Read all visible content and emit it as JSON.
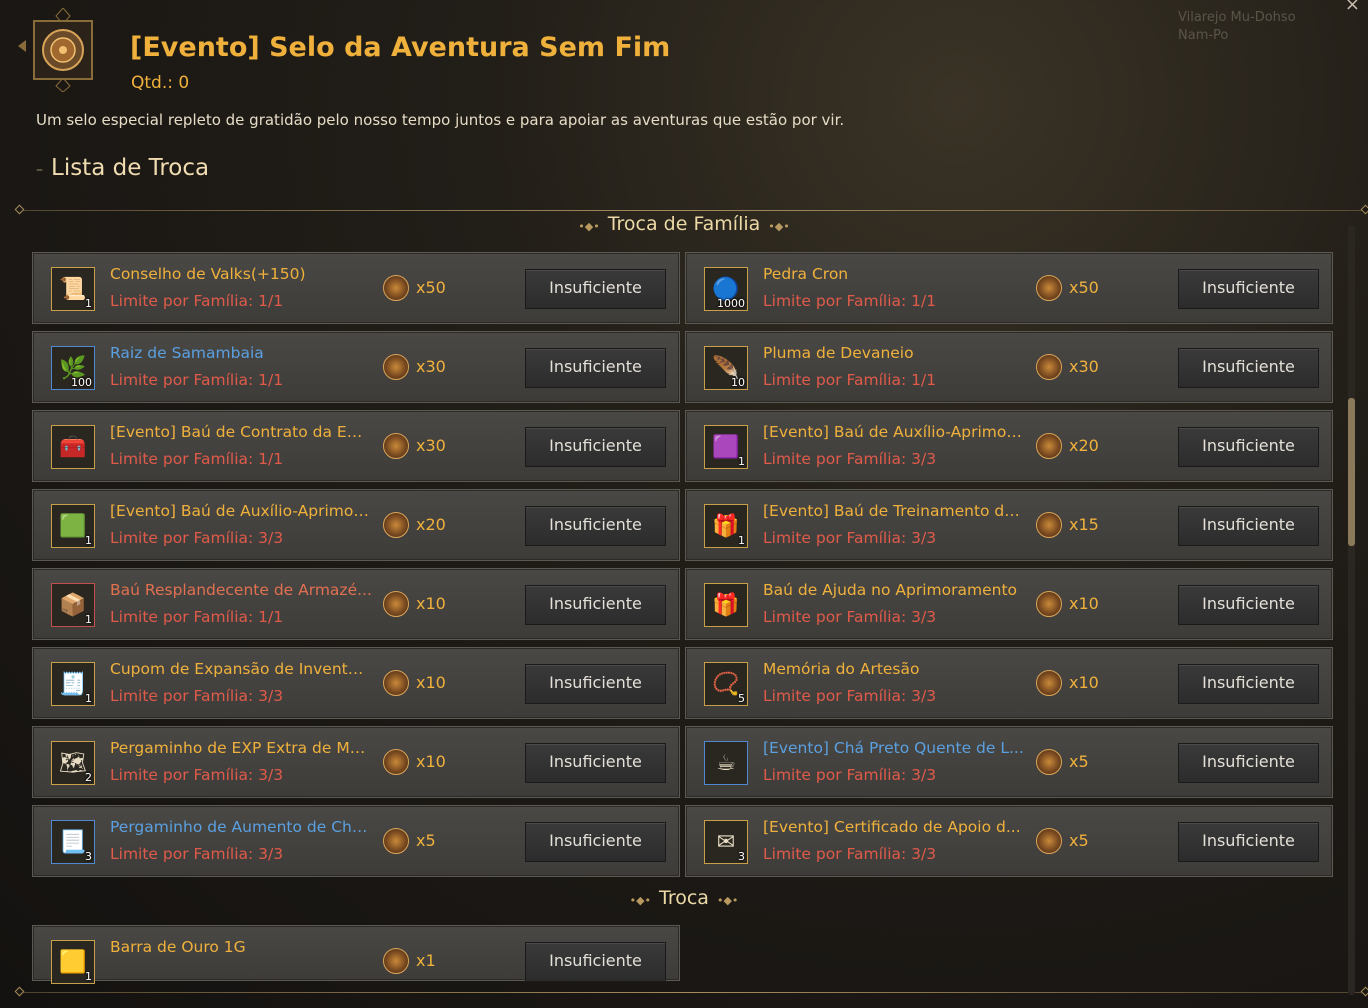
{
  "header": {
    "title": "[Evento] Selo da Aventura Sem Fim",
    "qty": "Qtd.: 0",
    "description": "Um selo especial repleto de gratidão pelo nosso tempo juntos e para apoiar as aventuras que estão por vir.",
    "list_title": "Lista de Troca"
  },
  "background": {
    "location": "Vilarejo Mu-Dohso",
    "location2": "Nam-Po"
  },
  "sections": {
    "family": "Troca de Família",
    "trade": "Troca"
  },
  "items": [
    {
      "name": "Conselho de Valks(+150)",
      "name_color": "gold",
      "limit": "Limite por Família: 1/1",
      "count": "1",
      "cost": "x50",
      "button": "Insuficiente",
      "icon": "scroll-icon",
      "icon_glyph": "📜",
      "border": "gold"
    },
    {
      "name": "Pedra Cron",
      "name_color": "gold",
      "limit": "Limite por Família: 1/1",
      "count": "1000",
      "cost": "x50",
      "button": "Insuficiente",
      "icon": "cron-stone-icon",
      "icon_glyph": "🔵",
      "border": "gold"
    },
    {
      "name": "Raiz de Samambaia",
      "name_color": "blue",
      "limit": "Limite por Família: 1/1",
      "count": "100",
      "cost": "x30",
      "button": "Insuficiente",
      "icon": "fern-icon",
      "icon_glyph": "🌿",
      "border": "blue"
    },
    {
      "name": "Pluma de Devaneio",
      "name_color": "gold",
      "limit": "Limite por Família: 1/1",
      "count": "10",
      "cost": "x30",
      "button": "Insuficiente",
      "icon": "feather-icon",
      "icon_glyph": "🪶",
      "border": "gold"
    },
    {
      "name": "[Evento] Baú de Contrato da Em...",
      "name_color": "gold",
      "limit": "Limite por Família: 1/1",
      "count": "",
      "cost": "x30",
      "button": "Insuficiente",
      "icon": "chest-icon",
      "icon_glyph": "🧰",
      "border": "gold"
    },
    {
      "name": "[Evento] Baú de Auxílio-Aprimor...",
      "name_color": "gold",
      "limit": "Limite por Família: 3/3",
      "count": "1",
      "cost": "x20",
      "button": "Insuficiente",
      "icon": "purple-box-icon",
      "icon_glyph": "🟪",
      "border": "gold"
    },
    {
      "name": "[Evento] Baú de Auxílio-Aprimor...",
      "name_color": "gold",
      "limit": "Limite por Família: 3/3",
      "count": "1",
      "cost": "x20",
      "button": "Insuficiente",
      "icon": "green-box-icon",
      "icon_glyph": "🟩",
      "border": "gold"
    },
    {
      "name": "[Evento] Baú de Treinamento de...",
      "name_color": "gold",
      "limit": "Limite por Família: 3/3",
      "count": "1",
      "cost": "x15",
      "button": "Insuficiente",
      "icon": "gift-box-icon",
      "icon_glyph": "🎁",
      "border": "gold"
    },
    {
      "name": "Baú Resplandecente de Armazé...",
      "name_color": "red",
      "limit": "Limite por Família: 1/1",
      "count": "1",
      "cost": "x10",
      "button": "Insuficiente",
      "icon": "storage-chest-icon",
      "icon_glyph": "📦",
      "border": "red"
    },
    {
      "name": "Baú de Ajuda no Aprimoramento",
      "name_color": "gold",
      "limit": "Limite por Família: 3/3",
      "count": "",
      "cost": "x10",
      "button": "Insuficiente",
      "icon": "gold-gift-icon",
      "icon_glyph": "🎁",
      "border": "gold"
    },
    {
      "name": "Cupom de Expansão de Inventár...",
      "name_color": "gold",
      "limit": "Limite por Família: 3/3",
      "count": "1",
      "cost": "x10",
      "button": "Insuficiente",
      "icon": "bag-coupon-icon",
      "icon_glyph": "🧾",
      "border": "gold"
    },
    {
      "name": "Memória do Artesão",
      "name_color": "gold",
      "limit": "Limite por Família: 3/3",
      "count": "5",
      "cost": "x10",
      "button": "Insuficiente",
      "icon": "pendant-icon",
      "icon_glyph": "📿",
      "border": "gold"
    },
    {
      "name": "Pergaminho de EXP Extra de Mo...",
      "name_color": "gold",
      "limit": "Limite por Família: 3/3",
      "count": "2",
      "cost": "x10",
      "button": "Insuficiente",
      "icon": "exp-scroll-icon",
      "icon_glyph": "🗺",
      "border": "gold"
    },
    {
      "name": "[Evento] Chá Preto Quente de L...",
      "name_color": "blue",
      "limit": "Limite por Família: 3/3",
      "count": "",
      "cost": "x5",
      "button": "Insuficiente",
      "icon": "tea-cup-icon",
      "icon_glyph": "☕",
      "border": "blue"
    },
    {
      "name": "Pergaminho de Aumento de Cha...",
      "name_color": "blue",
      "limit": "Limite por Família: 3/3",
      "count": "3",
      "cost": "x5",
      "button": "Insuficiente",
      "icon": "chance-scroll-icon",
      "icon_glyph": "📃",
      "border": "blue"
    },
    {
      "name": "[Evento] Certificado de Apoio d...",
      "name_color": "gold",
      "limit": "Limite por Família: 3/3",
      "count": "3",
      "cost": "x5",
      "button": "Insuficiente",
      "icon": "certificate-icon",
      "icon_glyph": "✉",
      "border": "gold"
    }
  ],
  "trade_items": [
    {
      "name": "Barra de Ouro 1G",
      "name_color": "gold",
      "limit": "",
      "count": "1",
      "cost": "x1",
      "button": "Insuficiente",
      "icon": "gold-bar-icon",
      "icon_glyph": "🟨",
      "border": "gold"
    }
  ]
}
